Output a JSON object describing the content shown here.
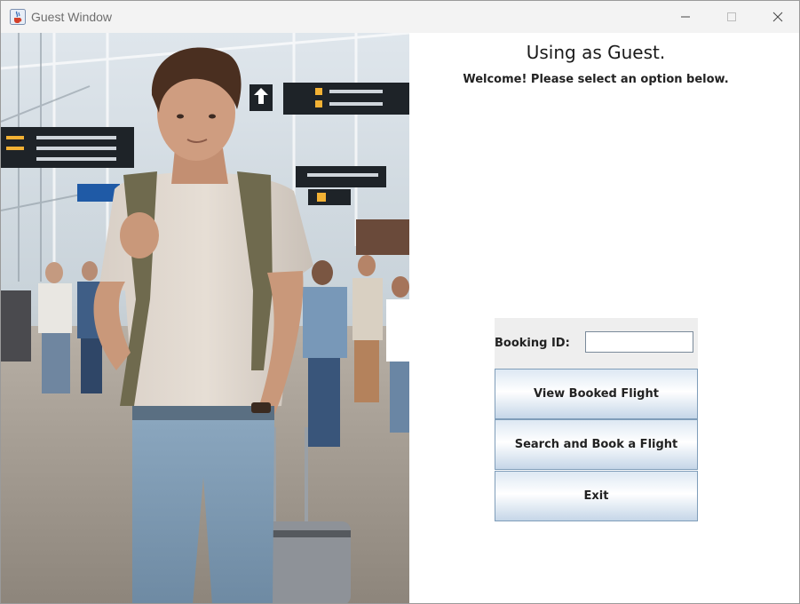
{
  "window": {
    "title": "Guest Window",
    "app_icon": "java-coffee-icon",
    "controls": {
      "minimize": "minimize-icon",
      "maximize": "maximize-icon",
      "close": "close-icon"
    }
  },
  "panel": {
    "heading": "Using as Guest.",
    "subheading": "Welcome! Please select an option below.",
    "booking": {
      "label": "Booking ID:",
      "value": "",
      "placeholder": ""
    },
    "buttons": {
      "view": "View Booked Flight",
      "search": "Search and Book a Flight",
      "exit": "Exit"
    }
  },
  "colors": {
    "button_border": "#7f9db9",
    "button_gradient_top": "#dde8f3",
    "button_gradient_bottom": "#c5d6e8",
    "booking_row_bg": "#eeeeee"
  }
}
